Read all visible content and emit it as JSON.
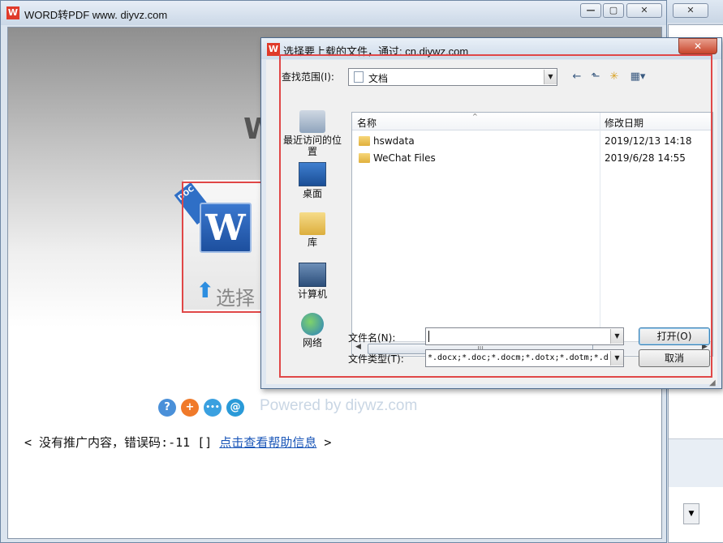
{
  "main_window": {
    "title": "WORD转PDF www. diyvz.com",
    "app_icon": "W",
    "minimize": "—",
    "maximize": "▢",
    "close": "✕",
    "big_title_fragment": "W",
    "doc_ribbon": "DOC",
    "word_letter": "W",
    "upload_arrow": "⬆",
    "choose_label": "选择",
    "powered_by": "Powered by diywz.com",
    "status": {
      "prefix": "< 没有推广内容，错误码:-11 [] ",
      "link": "点击查看帮助信息",
      "suffix": " >"
    },
    "action_icons": [
      {
        "name": "help-icon",
        "glyph": "?",
        "color": "#4a90d9"
      },
      {
        "name": "plus-icon",
        "glyph": "+",
        "color": "#f07a2a"
      },
      {
        "name": "chat-icon",
        "glyph": "•••",
        "color": "#3aa0e0"
      },
      {
        "name": "mail-icon",
        "glyph": "@",
        "color": "#2a9ad8"
      }
    ]
  },
  "background_window": {
    "close": "✕",
    "scroll_down": "▼"
  },
  "dialog": {
    "title": "选择要上载的文件，通过: cn.diywz.com",
    "app_icon": "W",
    "close": "✕",
    "look_in_label": "查找范围(I):",
    "look_in_value": "文档",
    "toolbar": {
      "back": "←",
      "up": "⬑",
      "new_folder": "✳",
      "view": "▦▾"
    },
    "places": [
      {
        "name": "最近访问的位置"
      },
      {
        "name": "桌面"
      },
      {
        "name": "库"
      },
      {
        "name": "计算机"
      },
      {
        "name": "网络"
      }
    ],
    "columns": {
      "name": "名称",
      "modified": "修改日期"
    },
    "files": [
      {
        "name": "hswdata",
        "modified": "2019/12/13 14:18"
      },
      {
        "name": "WeChat Files",
        "modified": "2019/6/28 14:55"
      }
    ],
    "filename_label": "文件名(N):",
    "filename_value": "",
    "filetype_label": "文件类型(T):",
    "filetype_value": "*.docx;*.doc;*.docm;*.dotx;*.dotm;*.d",
    "open_button": "打开(O)",
    "cancel_button": "取消"
  },
  "colors": {
    "highlight_red": "#e04747",
    "link_blue": "#1a56b8"
  }
}
